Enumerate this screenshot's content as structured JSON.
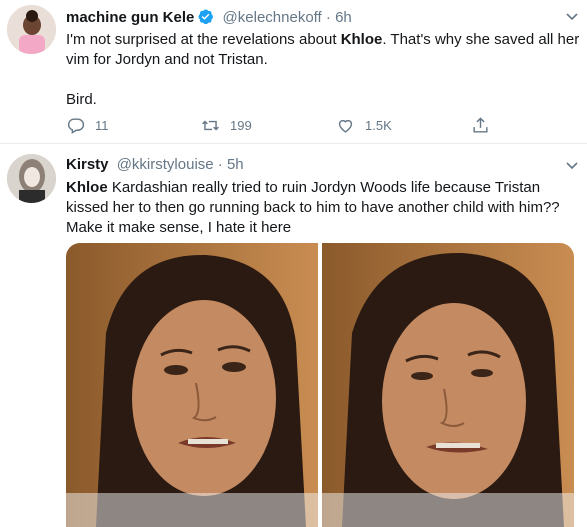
{
  "tweet1": {
    "display_name": "machine gun Kele",
    "handle": "@kelechnekoff",
    "time": "6h",
    "text_line1_prefix": "I'm not surprised at the revelations about ",
    "text_line1_bold": "Khloe",
    "text_line1_suffix": ". That's why she saved all her",
    "text_line2": "vim for Jordyn and not Tristan.",
    "text_line3": "Bird.",
    "replies": "11",
    "retweets": "199",
    "likes": "1.5K",
    "colors": {
      "verified": "#1da1f2"
    }
  },
  "tweet2": {
    "display_name": "Kirsty",
    "handle": "@kkirstylouise",
    "time": "5h",
    "text_bold": "Khloe",
    "text_line1_suffix": " Kardashian really tried to ruin Jordyn Woods life because Tristan",
    "text_line2": "kissed her to then go running back to him to have another child with him??",
    "text_line3": "Make it make sense, I hate it here"
  },
  "icons": [
    "reply-icon",
    "retweet-icon",
    "like-icon",
    "share-icon",
    "verified-icon"
  ]
}
